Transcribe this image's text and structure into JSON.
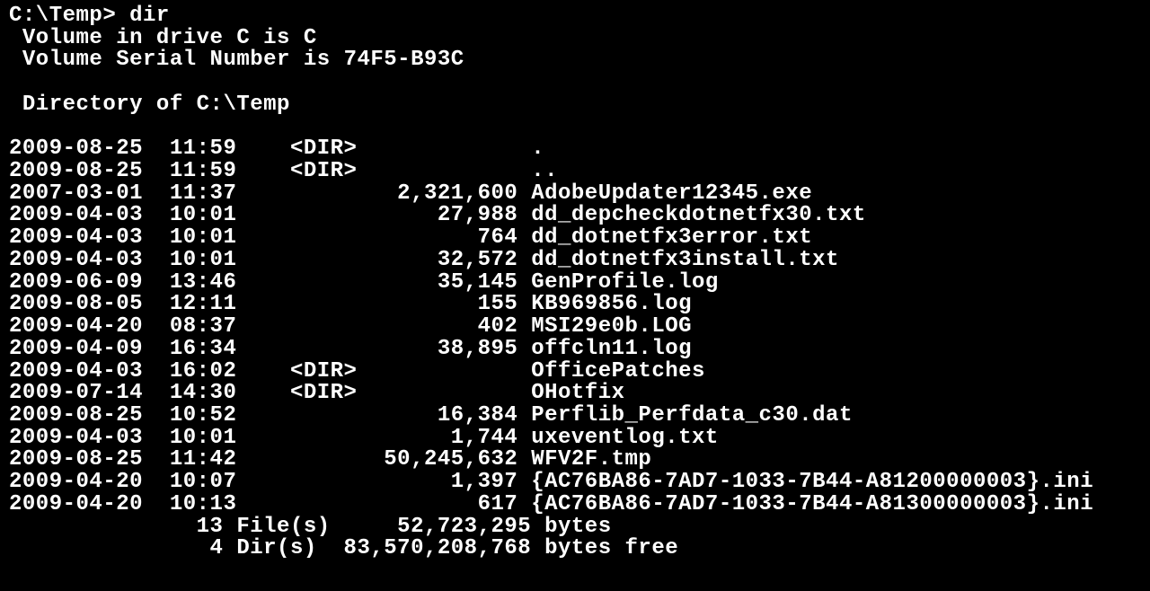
{
  "prompt": {
    "path": "C:\\Temp>",
    "command": "dir"
  },
  "volume": {
    "drive_label": "Volume in drive C is C",
    "serial": "Volume Serial Number is 74F5-B93C"
  },
  "directory_header": "Directory of C:\\Temp",
  "entries": [
    {
      "date": "2009-08-25",
      "time": "11:59",
      "type": "<DIR>",
      "size": "",
      "name": "."
    },
    {
      "date": "2009-08-25",
      "time": "11:59",
      "type": "<DIR>",
      "size": "",
      "name": ".."
    },
    {
      "date": "2007-03-01",
      "time": "11:37",
      "type": "",
      "size": "2,321,600",
      "name": "AdobeUpdater12345.exe"
    },
    {
      "date": "2009-04-03",
      "time": "10:01",
      "type": "",
      "size": "27,988",
      "name": "dd_depcheckdotnetfx30.txt"
    },
    {
      "date": "2009-04-03",
      "time": "10:01",
      "type": "",
      "size": "764",
      "name": "dd_dotnetfx3error.txt"
    },
    {
      "date": "2009-04-03",
      "time": "10:01",
      "type": "",
      "size": "32,572",
      "name": "dd_dotnetfx3install.txt"
    },
    {
      "date": "2009-06-09",
      "time": "13:46",
      "type": "",
      "size": "35,145",
      "name": "GenProfile.log"
    },
    {
      "date": "2009-08-05",
      "time": "12:11",
      "type": "",
      "size": "155",
      "name": "KB969856.log"
    },
    {
      "date": "2009-04-20",
      "time": "08:37",
      "type": "",
      "size": "402",
      "name": "MSI29e0b.LOG"
    },
    {
      "date": "2009-04-09",
      "time": "16:34",
      "type": "",
      "size": "38,895",
      "name": "offcln11.log"
    },
    {
      "date": "2009-04-03",
      "time": "16:02",
      "type": "<DIR>",
      "size": "",
      "name": "OfficePatches"
    },
    {
      "date": "2009-07-14",
      "time": "14:30",
      "type": "<DIR>",
      "size": "",
      "name": "OHotfix"
    },
    {
      "date": "2009-08-25",
      "time": "10:52",
      "type": "",
      "size": "16,384",
      "name": "Perflib_Perfdata_c30.dat"
    },
    {
      "date": "2009-04-03",
      "time": "10:01",
      "type": "",
      "size": "1,744",
      "name": "uxeventlog.txt"
    },
    {
      "date": "2009-08-25",
      "time": "11:42",
      "type": "",
      "size": "50,245,632",
      "name": "WFV2F.tmp"
    },
    {
      "date": "2009-04-20",
      "time": "10:07",
      "type": "",
      "size": "1,397",
      "name": "{AC76BA86-7AD7-1033-7B44-A81200000003}.ini"
    },
    {
      "date": "2009-04-20",
      "time": "10:13",
      "type": "",
      "size": "617",
      "name": "{AC76BA86-7AD7-1033-7B44-A81300000003}.ini"
    }
  ],
  "summary": {
    "file_count": "13",
    "file_label": "File(s)",
    "total_size": "52,723,295",
    "size_unit": "bytes",
    "dir_count": "4",
    "dir_label": "Dir(s)",
    "free_space": "83,570,208,768",
    "free_label": "bytes free"
  }
}
